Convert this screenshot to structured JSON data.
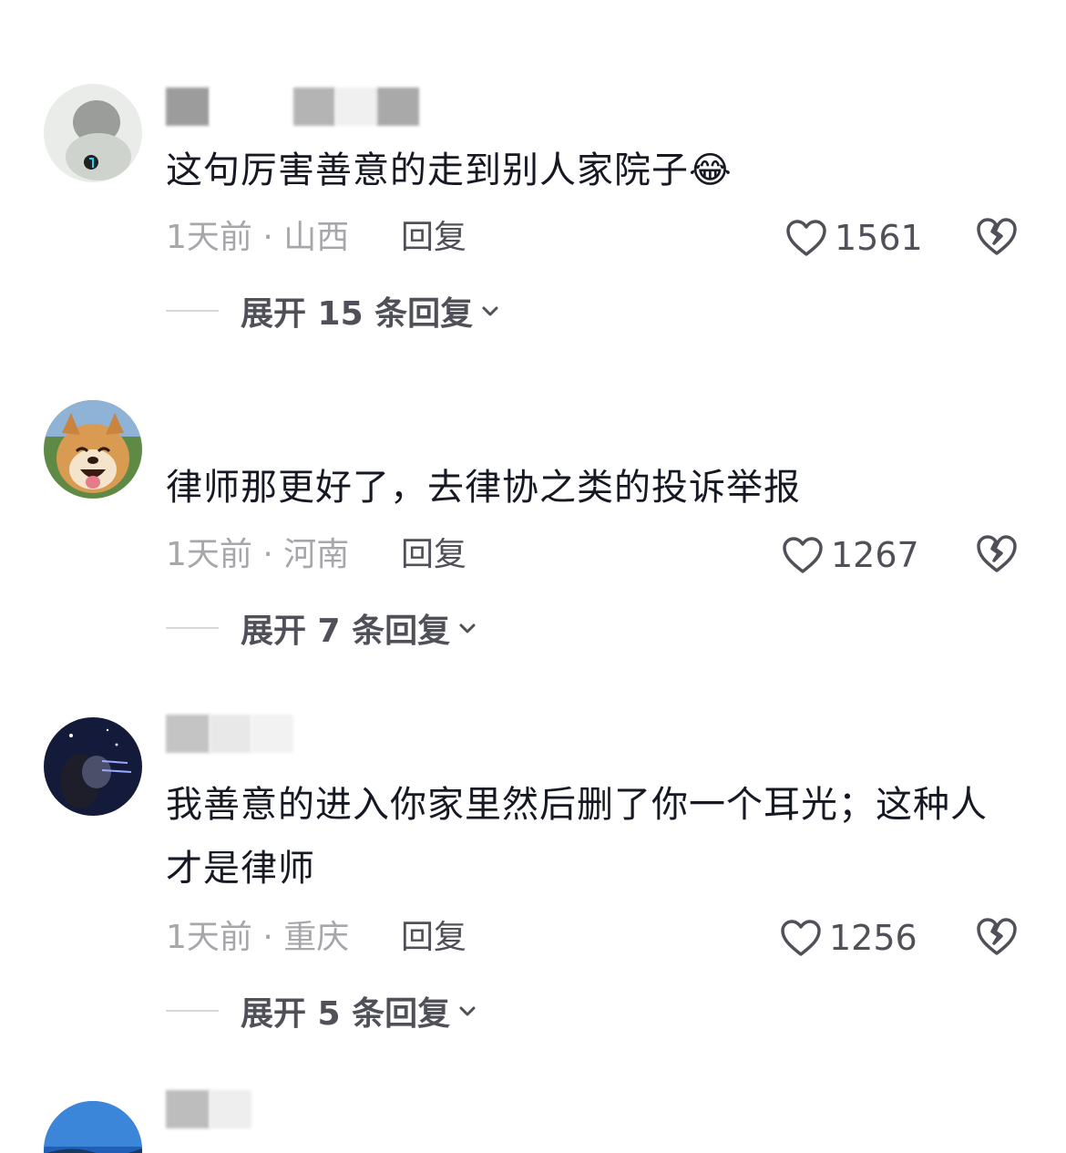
{
  "comments": [
    {
      "text": "这句厉害善意的走到别人家院子",
      "emoji": "😂",
      "meta": "1天前 · 山西",
      "reply_label": "回复",
      "likes": "1561",
      "expand_label": "展开 15 条回复"
    },
    {
      "text": "律师那更好了，去律协之类的投诉举报",
      "meta": "1天前 · 河南",
      "reply_label": "回复",
      "likes": "1267",
      "expand_label": "展开 7 条回复"
    },
    {
      "text": "我善意的进入你家里然后删了你一个耳光；这种人才是律师",
      "meta": "1天前 · 重庆",
      "reply_label": "回复",
      "likes": "1256",
      "expand_label": "展开 5 条回复"
    }
  ],
  "colors": {
    "text_primary": "#161823",
    "text_secondary": "#a7a7ab",
    "text_action": "#505059",
    "divider": "#d8d8da"
  },
  "icons": {
    "like": "heart-outline-icon",
    "dislike": "broken-heart-icon",
    "expand": "chevron-down-icon"
  }
}
